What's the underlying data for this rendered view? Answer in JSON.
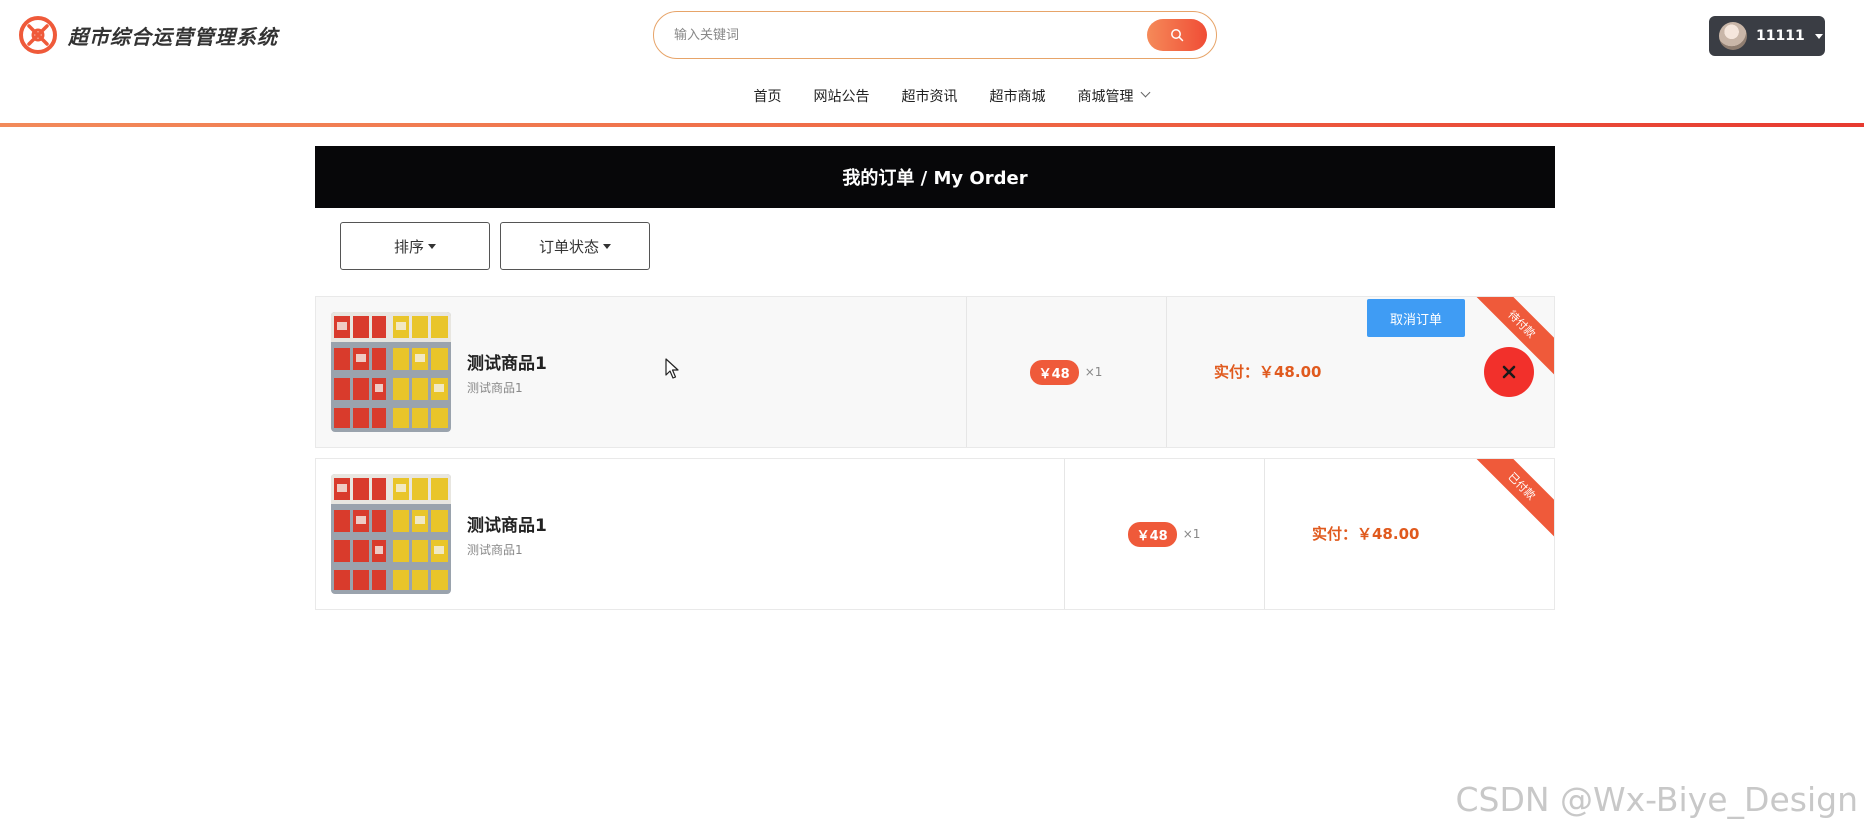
{
  "app": {
    "title": "超市综合运营管理系统"
  },
  "search": {
    "placeholder": "输入关键词"
  },
  "user": {
    "name": "11111"
  },
  "nav": {
    "items": [
      {
        "label": "首页"
      },
      {
        "label": "网站公告"
      },
      {
        "label": "超市资讯"
      },
      {
        "label": "超市商城"
      },
      {
        "label": "商城管理"
      }
    ]
  },
  "page": {
    "title": "我的订单 / My Order"
  },
  "filters": {
    "sort_label": "排序",
    "status_label": "订单状态"
  },
  "orders": [
    {
      "name": "测试商品1",
      "desc": "测试商品1",
      "price": "￥48",
      "qty": "×1",
      "paid": "实付：￥48.00",
      "status": "待付款",
      "cancel_label": "取消订单"
    },
    {
      "name": "测试商品1",
      "desc": "测试商品1",
      "price": "￥48",
      "qty": "×1",
      "paid": "实付：￥48.00",
      "status": "已付款"
    }
  ],
  "watermark": "CSDN @Wx-Biye_Design",
  "colors": {
    "accent": "#ef5a3a",
    "paid_text": "#e05a1e",
    "cancel_button": "#3f9cf4",
    "delete_button": "#f2302b",
    "title_bar": "#070709"
  },
  "icons": {
    "logo": "logo-icon",
    "search": "search-icon",
    "delete": "close-icon"
  }
}
